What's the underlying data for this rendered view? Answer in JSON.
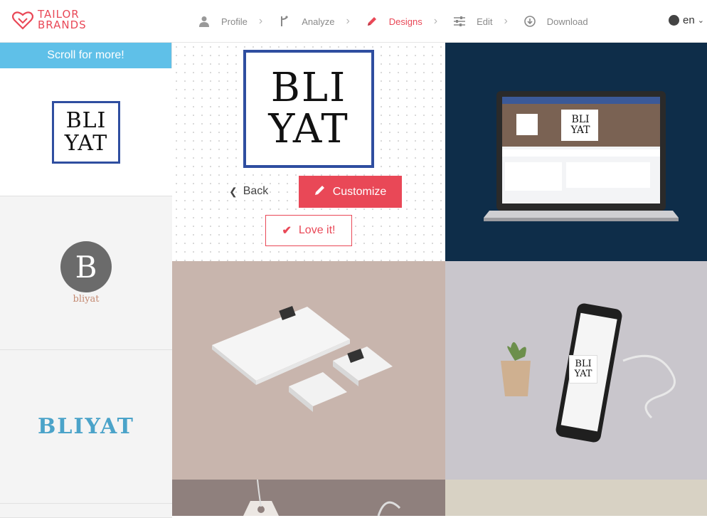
{
  "brand": {
    "line1": "TAILOR",
    "line2": "BRANDS",
    "accent": "#e94857",
    "icon": "heart-logo-icon"
  },
  "steps": [
    {
      "label": "Profile",
      "icon": "user-icon",
      "active": false
    },
    {
      "label": "Analyze",
      "icon": "analyze-icon",
      "active": false
    },
    {
      "label": "Designs",
      "icon": "pencil-icon",
      "active": true
    },
    {
      "label": "Edit",
      "icon": "sliders-icon",
      "active": false
    },
    {
      "label": "Download",
      "icon": "download-icon",
      "active": false
    }
  ],
  "language": {
    "value": "en",
    "icon": "globe-icon"
  },
  "sidebar": {
    "banner": "Scroll for more!",
    "thumbs": {
      "one": {
        "line1": "BLI",
        "line2": "YAT"
      },
      "two": {
        "letter": "B",
        "name": "bliyat"
      },
      "three": {
        "word": "BLIYAT"
      }
    }
  },
  "main": {
    "logo": {
      "line1": "BLI",
      "line2": "YAT"
    },
    "back_label": "Back",
    "customize_label": "Customize",
    "love_label": "Love it!"
  },
  "mockups": {
    "laptop": {
      "line1": "BLI",
      "line2": "YAT"
    },
    "phone": {
      "line1": "BLI",
      "line2": "YAT"
    }
  },
  "colors": {
    "banner": "#5fc0e8",
    "logo_border": "#2f4ea0",
    "laptop_bg": "#0e2d49"
  }
}
